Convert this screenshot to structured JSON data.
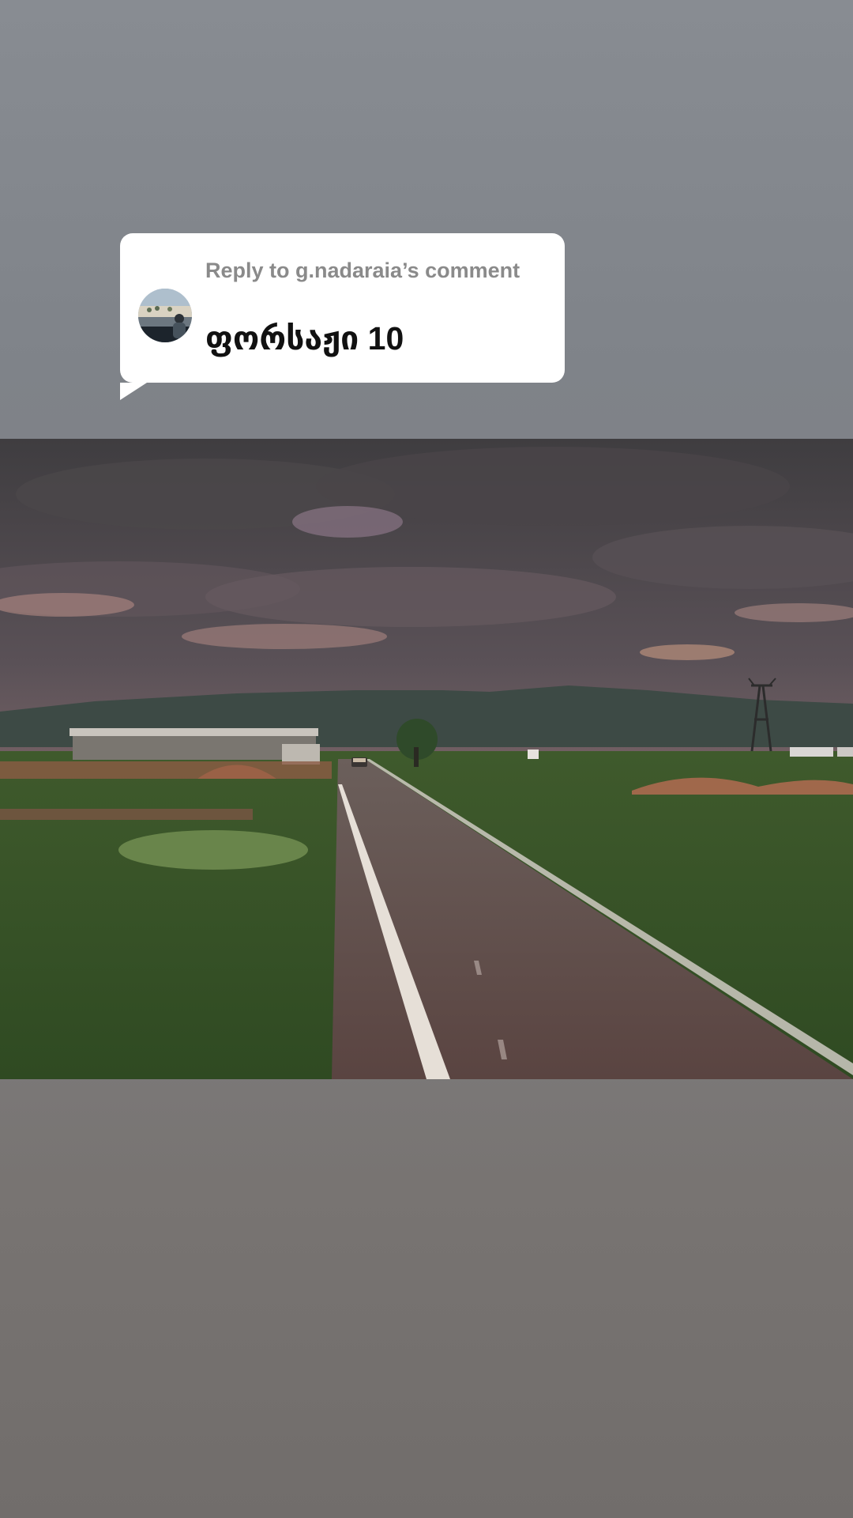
{
  "reply": {
    "label": "Reply to g.nadaraia’s comment",
    "text": "ფორსაჟი 10"
  },
  "video": {
    "description": "timelapse of a rural road under cloudy sky"
  },
  "colors": {
    "background_top": "#888c92",
    "background_bottom": "#716d6b",
    "bubble": "#ffffff",
    "label": "#8a8a8a",
    "text": "#111111"
  },
  "icons": {
    "avatar": "avatar-icon"
  }
}
